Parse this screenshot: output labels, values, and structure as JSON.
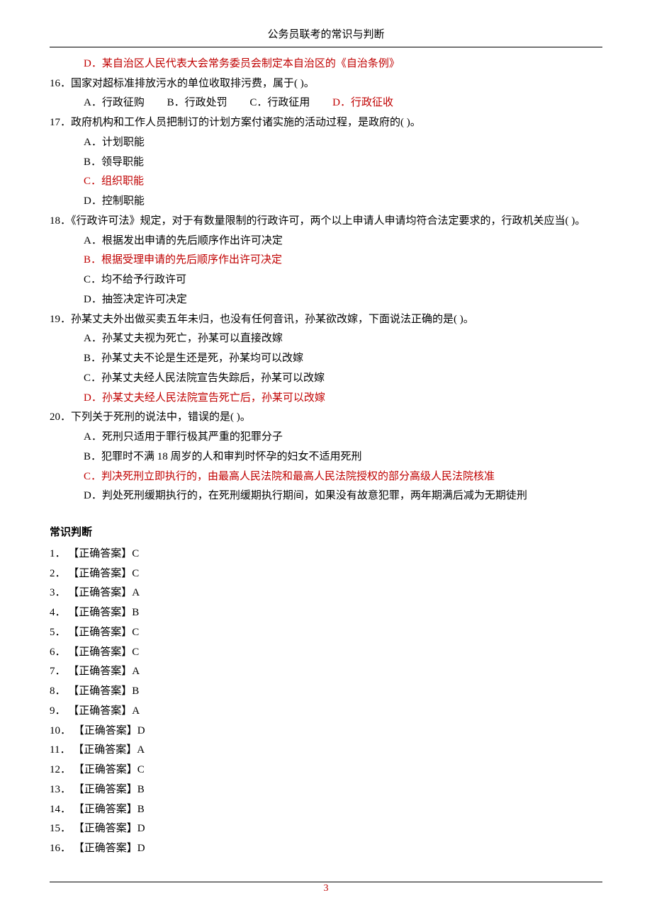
{
  "header": {
    "title": "公务员联考的常识与判断"
  },
  "questions": {
    "q15d": {
      "label": "D．",
      "text": "某自治区人民代表大会常务委员会制定本自治区的《自治条例》"
    },
    "q16": {
      "num": "16．",
      "text": "国家对超标准排放污水的单位收取排污费，属于( )。",
      "opts": {
        "a": "A．行政征购",
        "b": "B．行政处罚",
        "c": "C．行政征用",
        "d": "D．行政征收"
      }
    },
    "q17": {
      "num": "17．",
      "text": "政府机构和工作人员把制订的计划方案付诸实施的活动过程，是政府的( )。",
      "a": "A．计划职能",
      "b": "B．领导职能",
      "c": "C．组织职能",
      "d": "D．控制职能"
    },
    "q18": {
      "num": "18．",
      "text": "《行政许可法》规定，对于有数量限制的行政许可，两个以上申请人申请均符合法定要求的，行政机关应当( )。",
      "a": "A．根据发出申请的先后顺序作出许可决定",
      "b": "B．根据受理申请的先后顺序作出许可决定",
      "c": "C．均不给予行政许可",
      "d": "D．抽签决定许可决定"
    },
    "q19": {
      "num": "19．",
      "text": "孙某丈夫外出做买卖五年未归，也没有任何音讯，孙某欲改嫁，下面说法正确的是( )。",
      "a": "A．孙某丈夫视为死亡，孙某可以直接改嫁",
      "b": "B．孙某丈夫不论是生还是死，孙某均可以改嫁",
      "c": "C．孙某丈夫经人民法院宣告失踪后，孙某可以改嫁",
      "d": "D．孙某丈夫经人民法院宣告死亡后，孙某可以改嫁"
    },
    "q20": {
      "num": "20．",
      "text": "下列关于死刑的说法中，错误的是( )。",
      "a": "A．死刑只适用于罪行极其严重的犯罪分子",
      "b": "B．犯罪时不满 18 周岁的人和审判时怀孕的妇女不适用死刑",
      "c": "C．判决死刑立即执行的，由最高人民法院和最高人民法院授权的部分高级人民法院核准",
      "d": "D．判处死刑缓期执行的，在死刑缓期执行期间，如果没有故意犯罪，两年期满后减为无期徒刑"
    }
  },
  "answers": {
    "title": "常识判断",
    "label": "【正确答案】",
    "items": [
      {
        "n": "1．",
        "v": "C"
      },
      {
        "n": "2．",
        "v": "C"
      },
      {
        "n": "3．",
        "v": "A"
      },
      {
        "n": "4．",
        "v": "B"
      },
      {
        "n": "5．",
        "v": "C"
      },
      {
        "n": "6．",
        "v": "C"
      },
      {
        "n": "7．",
        "v": "A"
      },
      {
        "n": "8．",
        "v": "B"
      },
      {
        "n": "9．",
        "v": "A"
      },
      {
        "n": "10．",
        "v": "D"
      },
      {
        "n": "11．",
        "v": "A"
      },
      {
        "n": "12．",
        "v": "C"
      },
      {
        "n": "13．",
        "v": "B"
      },
      {
        "n": "14．",
        "v": "B"
      },
      {
        "n": "15．",
        "v": "D"
      },
      {
        "n": "16．",
        "v": "D"
      }
    ]
  },
  "page": {
    "num": "3"
  }
}
